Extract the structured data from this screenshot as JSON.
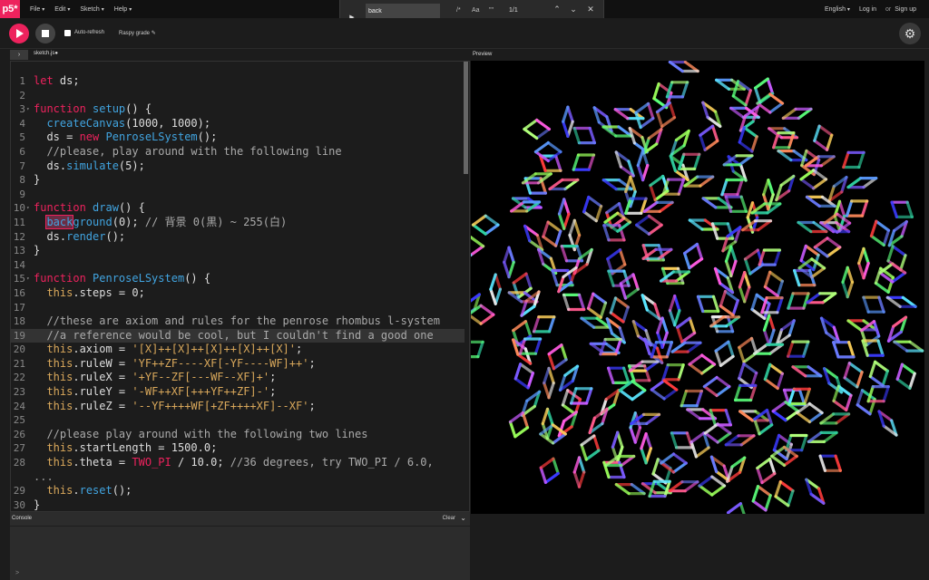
{
  "nav": {
    "logo": "p5*",
    "menus": [
      "File",
      "Edit",
      "Sketch",
      "Help"
    ],
    "language": "English",
    "login": "Log in",
    "or": "or",
    "signup": "Sign up"
  },
  "find": {
    "query": "back",
    "regex": "/*",
    "case": "Aa",
    "word": "\"\"",
    "count": "1/1"
  },
  "toolbar": {
    "autorefresh_label": "Auto-refresh",
    "autorefresh_checked": false,
    "sketch_name": "Raspy grade"
  },
  "editor": {
    "file_tab": "sketch.js●",
    "active_line": 19,
    "find_highlight_line": 11,
    "lines": [
      {
        "n": "1",
        "text": "let ds;"
      },
      {
        "n": "2",
        "text": ""
      },
      {
        "n": "3",
        "text": "function setup() {",
        "fold": true
      },
      {
        "n": "4",
        "text": "  createCanvas(1000, 1000);"
      },
      {
        "n": "5",
        "text": "  ds = new PenroseLSystem();"
      },
      {
        "n": "6",
        "text": "  //please, play around with the following line"
      },
      {
        "n": "7",
        "text": "  ds.simulate(5);"
      },
      {
        "n": "8",
        "text": "}"
      },
      {
        "n": "9",
        "text": ""
      },
      {
        "n": "10",
        "text": "function draw() {",
        "fold": true
      },
      {
        "n": "11",
        "text": "  background(0); // 背景 0(黒) ~ 255(白)"
      },
      {
        "n": "12",
        "text": "  ds.render();"
      },
      {
        "n": "13",
        "text": "}"
      },
      {
        "n": "14",
        "text": ""
      },
      {
        "n": "15",
        "text": "function PenroseLSystem() {",
        "fold": true
      },
      {
        "n": "16",
        "text": "  this.steps = 0;"
      },
      {
        "n": "17",
        "text": ""
      },
      {
        "n": "18",
        "text": "  //these are axiom and rules for the penrose rhombus l-system"
      },
      {
        "n": "19",
        "text": "  //a reference would be cool, but I couldn't find a good one"
      },
      {
        "n": "20",
        "text": "  this.axiom = '[X]++[X]++[X]++[X]++[X]';"
      },
      {
        "n": "21",
        "text": "  this.ruleW = 'YF++ZF----XF[-YF----WF]++';"
      },
      {
        "n": "22",
        "text": "  this.ruleX = '+YF--ZF[---WF--XF]+';"
      },
      {
        "n": "23",
        "text": "  this.ruleY = '-WF++XF[+++YF++ZF]-';"
      },
      {
        "n": "24",
        "text": "  this.ruleZ = '--YF++++WF[+ZF++++XF]--XF';"
      },
      {
        "n": "25",
        "text": ""
      },
      {
        "n": "26",
        "text": "  //please play around with the following two lines"
      },
      {
        "n": "27",
        "text": "  this.startLength = 1500.0;"
      },
      {
        "n": "28",
        "text": "  this.theta = TWO_PI / 10.0; //36 degrees, try TWO_PI / 6.0,"
      },
      {
        "n": "",
        "text": "..."
      },
      {
        "n": "29",
        "text": "  this.reset();"
      },
      {
        "n": "30",
        "text": "}"
      }
    ]
  },
  "console": {
    "title": "Console",
    "clear_label": "Clear",
    "prompt": ">"
  },
  "preview": {
    "label": "Preview"
  },
  "colors": {
    "accent": "#ed225d",
    "background": "#1c1c1c",
    "keyword": "#ed225d",
    "function": "#41a4e0",
    "string": "#d9a85b",
    "comment": "#aaaaaa"
  }
}
